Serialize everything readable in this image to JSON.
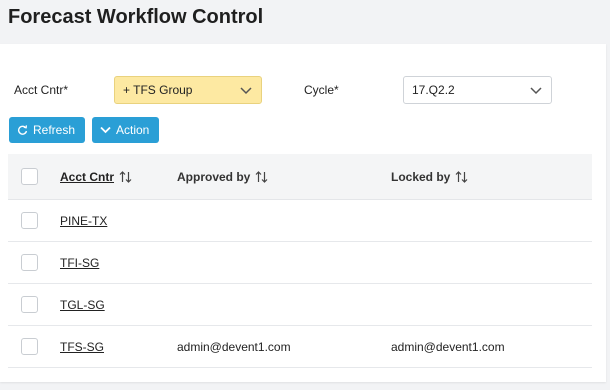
{
  "page": {
    "title": "Forecast Workflow Control"
  },
  "filters": {
    "acct_cntr_label": "Acct Cntr*",
    "acct_cntr_value": "+ TFS Group",
    "cycle_label": "Cycle*",
    "cycle_value": "17.Q2.2"
  },
  "toolbar": {
    "refresh_label": "Refresh",
    "action_label": "Action"
  },
  "grid": {
    "columns": [
      "Acct Cntr",
      "Approved by",
      "Locked by"
    ],
    "rows": [
      {
        "acct_cntr": "PINE-TX",
        "approved_by": "",
        "locked_by": ""
      },
      {
        "acct_cntr": "TFI-SG",
        "approved_by": "",
        "locked_by": ""
      },
      {
        "acct_cntr": "TGL-SG",
        "approved_by": "",
        "locked_by": ""
      },
      {
        "acct_cntr": "TFS-SG",
        "approved_by": "admin@devent1.com",
        "locked_by": "admin@devent1.com"
      }
    ]
  },
  "colors": {
    "accent": "#2a9fd6",
    "highlight_select": "#fde9a2"
  }
}
